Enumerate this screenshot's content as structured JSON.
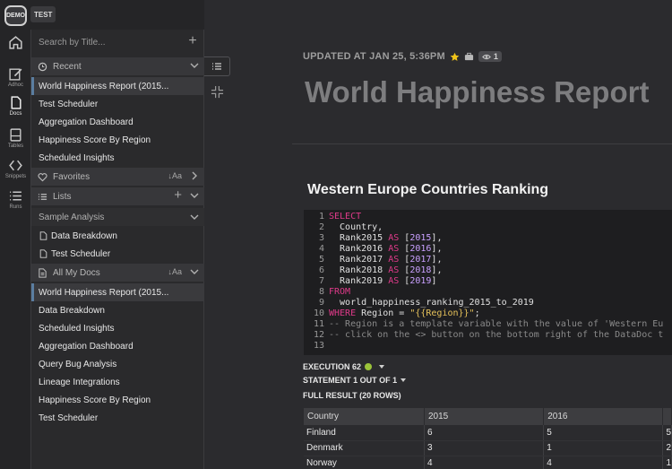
{
  "env": {
    "demo": "DEMO",
    "test": "TEST"
  },
  "rail": [
    {
      "name": "home",
      "label": ""
    },
    {
      "name": "adhoc",
      "label": "Adhoc"
    },
    {
      "name": "docs",
      "label": "Docs"
    },
    {
      "name": "tables",
      "label": "Tables"
    },
    {
      "name": "snippets",
      "label": "Snippets"
    },
    {
      "name": "runs",
      "label": "Runs"
    }
  ],
  "navigator": {
    "search_placeholder": "Search by Title...",
    "recent": {
      "label": "Recent",
      "items": [
        "World Happiness Report (2015...",
        "Test Scheduler",
        "Aggregation Dashboard",
        "Happiness Score By Region",
        "Scheduled Insights"
      ]
    },
    "favorites": {
      "label": "Favorites",
      "sort": "↓Aa"
    },
    "lists": {
      "label": "Lists",
      "sample_analysis": "Sample Analysis",
      "items": [
        "Data Breakdown",
        "Test Scheduler"
      ]
    },
    "all_docs": {
      "label": "All My Docs",
      "sort": "↓Aa",
      "items": [
        "World Happiness Report (2015...",
        "Data Breakdown",
        "Scheduled Insights",
        "Aggregation Dashboard",
        "Query Bug Analysis",
        "Lineage Integrations",
        "Happiness Score By Region",
        "Test Scheduler"
      ]
    }
  },
  "doc": {
    "updated": "UPDATED AT JAN 25, 5:36PM",
    "views": "1",
    "title": "World Happiness Report",
    "cell_title": "Western Europe Countries Ranking",
    "code": [
      {
        "n": "1",
        "parts": [
          [
            "kw",
            "SELECT"
          ]
        ]
      },
      {
        "n": "2",
        "parts": [
          [
            "id",
            "  Country,"
          ]
        ]
      },
      {
        "n": "3",
        "parts": [
          [
            "id",
            "  Rank2015 "
          ],
          [
            "kw",
            "AS"
          ],
          [
            "id",
            " ["
          ],
          [
            "br",
            "2015"
          ],
          [
            "id",
            "],"
          ]
        ]
      },
      {
        "n": "4",
        "parts": [
          [
            "id",
            "  Rank2016 "
          ],
          [
            "kw",
            "AS"
          ],
          [
            "id",
            " ["
          ],
          [
            "br",
            "2016"
          ],
          [
            "id",
            "],"
          ]
        ]
      },
      {
        "n": "5",
        "parts": [
          [
            "id",
            "  Rank2017 "
          ],
          [
            "kw",
            "AS"
          ],
          [
            "id",
            " ["
          ],
          [
            "br",
            "2017"
          ],
          [
            "id",
            "],"
          ]
        ]
      },
      {
        "n": "6",
        "parts": [
          [
            "id",
            "  Rank2018 "
          ],
          [
            "kw",
            "AS"
          ],
          [
            "id",
            " ["
          ],
          [
            "br",
            "2018"
          ],
          [
            "id",
            "],"
          ]
        ]
      },
      {
        "n": "7",
        "parts": [
          [
            "id",
            "  Rank2019 "
          ],
          [
            "kw",
            "AS"
          ],
          [
            "id",
            " ["
          ],
          [
            "br",
            "2019"
          ],
          [
            "id",
            "]"
          ]
        ]
      },
      {
        "n": "8",
        "parts": [
          [
            "kw",
            "FROM"
          ]
        ]
      },
      {
        "n": "9",
        "parts": [
          [
            "id",
            "  world_happiness_ranking_2015_to_2019"
          ]
        ]
      },
      {
        "n": "10",
        "parts": [
          [
            "kw",
            "WHERE"
          ],
          [
            "id",
            " Region = "
          ],
          [
            "str",
            "\"{{Region}}\""
          ],
          [
            "id",
            ";"
          ]
        ]
      },
      {
        "n": "11",
        "parts": [
          [
            "cm",
            "-- Region is a template variable with the value of 'Western Eu"
          ]
        ]
      },
      {
        "n": "12",
        "parts": [
          [
            "cm",
            "-- click on the <> button on the bottom right of the DataDoc t"
          ]
        ]
      },
      {
        "n": "13",
        "parts": []
      }
    ],
    "execution": "EXECUTION 62",
    "statement": "STATEMENT 1 OUT OF 1",
    "full_result": "FULL RESULT (20 ROWS)",
    "table": {
      "headers": [
        "Country",
        "2015",
        "2016",
        ""
      ],
      "rows": [
        [
          "Finland",
          "6",
          "5",
          "5"
        ],
        [
          "Denmark",
          "3",
          "1",
          "2"
        ],
        [
          "Norway",
          "4",
          "4",
          "1"
        ]
      ]
    }
  },
  "colors": {
    "accent_selected": "#5b7ea1",
    "status_green": "#9bc33a",
    "keyword": "#e03a8a",
    "bracket": "#c9a0ff",
    "string": "#e5c15a"
  }
}
